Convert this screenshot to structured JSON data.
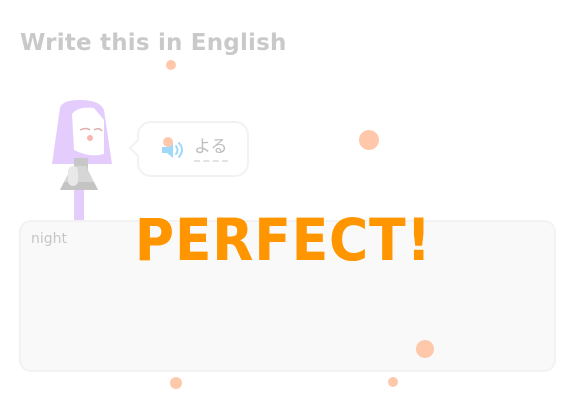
{
  "prompt": {
    "title": "Write this in English"
  },
  "exercise": {
    "prompt_word": "よる",
    "speaker_icon": "speaker-icon",
    "character_icon": "character-avatar"
  },
  "answer": {
    "value": "night"
  },
  "feedback": {
    "message": "PERFECT!",
    "color": "#ff9600"
  },
  "colors": {
    "title": "#c9c9c9",
    "confetti": "#ffc8aa",
    "speaker": "#1cb0f6",
    "character_hair": "#ce82ff"
  }
}
